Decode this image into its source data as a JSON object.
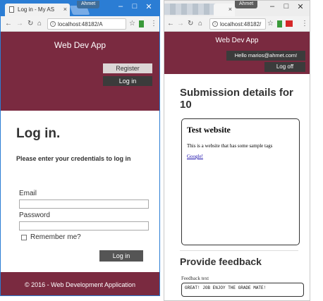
{
  "left_window": {
    "tab_title": "Log in - My AS",
    "profile_badge": "Ahmet",
    "address": "localhost:48182/A",
    "navbar": {
      "brand": "Web Dev App",
      "register": "Register",
      "login": "Log in"
    },
    "page": {
      "title": "Log in.",
      "subtitle": "Please enter your credentials to log in",
      "email_label": "Email",
      "email_value": "",
      "password_label": "Password",
      "password_value": "",
      "remember_label": "Remember me?",
      "submit": "Log in"
    },
    "footer": "© 2016 - Web Development Application"
  },
  "right_window": {
    "profile_badge": "Ahmet",
    "address": "localhost:48182/",
    "navbar": {
      "brand": "Web Dev App",
      "hello": "Hello marios@ahmet.com!",
      "logoff": "Log off"
    },
    "page": {
      "title": "Submission details for 10",
      "preview_title": "Test website",
      "preview_text": "This is a website that has some sample tags",
      "preview_link": "Google!",
      "feedback_title": "Provide feedback",
      "feedback_label": "Feedback text",
      "feedback_value": "GREAT! JOB ENJOY THE GRADE MATE!"
    }
  },
  "colors": {
    "navbar": "#7a2a40",
    "titlebar_active": "#2b7dd4",
    "nav_button_dark": "#3b3b3b"
  }
}
